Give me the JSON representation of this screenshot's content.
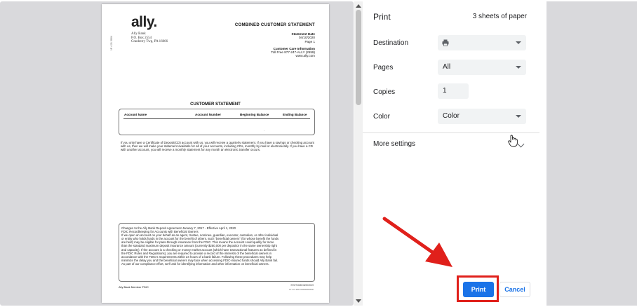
{
  "document": {
    "logo": "ally.",
    "address": [
      "Ally Bank",
      "P.O. Box 2554",
      "Cranberry Twp, PA 16066"
    ],
    "side_code": "1P 4 21 2004",
    "statement_title": "COMBINED CUSTOMER STATEMENT",
    "statement_date_label": "Statement Date",
    "statement_date": "04/10/2020",
    "page_num": "Page 1",
    "care_label": "Customer Care Information",
    "care_phone": "Toll Free 877-247-ALLY (2559)",
    "care_web": "www.ally.com",
    "customer_statement": "CUSTOMER STATEMENT",
    "columns": [
      "Account Name",
      "Account Number",
      "Beginning Balance",
      "Ending Balance"
    ],
    "blank_mark": ".",
    "notice": "If you only have a Certificate of Deposit(CD) account with us, you will receive a quarterly statement. If you have a savings or checking account with us, then we will make your statement available for all of your accounts, including CDs, monthly by mail or electronically. If you have a CD with another account, you will receive a monthly statement for any month an electronic transfer occurs.",
    "fdic_lines": [
      "Changes to the Ally Bank Deposit Agreement January 7, 2017 - Effective April 1, 2020",
      "FDIC Recordkeeping for Accounts with Beneficial Owners",
      "If we open an account on your behalf as an agent, trustee, nominee, guardian, executor, custodian, or other individual",
      "or entity who holds funds in the account for the benefit of others, such \"beneficial owners\" (for whose benefit the funds",
      "are held) may be eligible for pass-through insurance from the FDIC. This means the account could qualify for more",
      "than the standard maximum deposit insurance amount (currently $250,000 per depositor in the same ownership right",
      "and capacity). If the account is a checking or money market account (which have transactional features as defined in",
      "the FDIC Rules and Regulations), you are required to provide a record of the interests of the beneficial owners in",
      "accordance with the FDIC's requirements within 24 hours of a bank failure. Following these procedures may help",
      "minimize the delay you and the beneficial owners may face when accessing FDIC-insured funds should Ally Bank fail.",
      "As part of our compliance effort, we'll ask for identifying information and other information on beneficial owners."
    ],
    "footer_left": "Ally Bank Member FDIC",
    "footer_right": "STMTCMB 08/20/2019",
    "footer_tiny": "1P 4 21 2004 0000000000000"
  },
  "panel": {
    "title": "Print",
    "sheets": "3 sheets of paper",
    "destination_label": "Destination",
    "destination_value": "",
    "pages_label": "Pages",
    "pages_value": "All",
    "copies_label": "Copies",
    "copies_value": "1",
    "color_label": "Color",
    "color_value": "Color",
    "more_settings": "More settings",
    "print_button": "Print",
    "cancel_button": "Cancel"
  },
  "colors": {
    "accent": "#1a73e8",
    "annotation": "#e0201b",
    "preview_bg": "#d9d9dc"
  },
  "icons": [
    "printer-icon",
    "caret-down-icon",
    "chevron-down-icon",
    "hand-cursor-icon",
    "arrow-annotation"
  ]
}
